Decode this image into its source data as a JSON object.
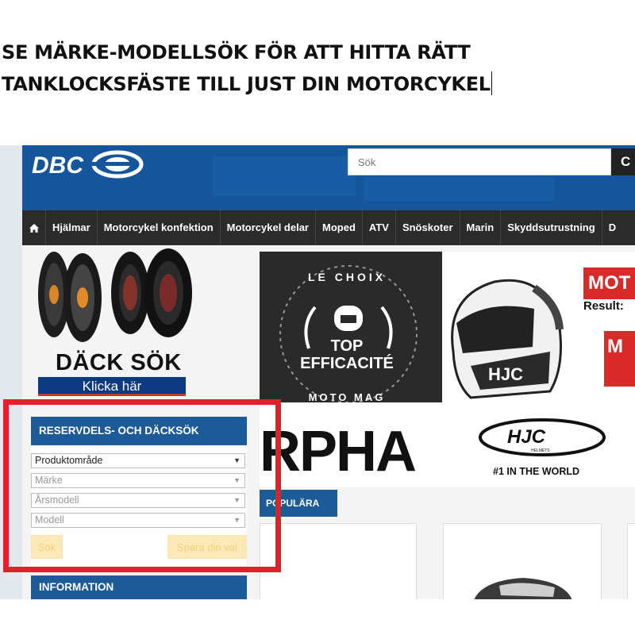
{
  "instruction": {
    "line1": "SE MÄRKE-MODELLSÖK FÖR ATT HITTA RÄTT",
    "line2": "TANKLOCKSFÄSTE TILL JUST DIN MOTORCYKEL"
  },
  "site": {
    "logo_text": "DBC",
    "search_placeholder": "Sök",
    "search_button": "C"
  },
  "nav": {
    "home_icon": "home-icon",
    "items": [
      "Hjälmar",
      "Motorcykel konfektion",
      "Motorcykel delar",
      "Moped",
      "ATV",
      "Snöskoter",
      "Marin",
      "Skyddsutrustning",
      "D"
    ]
  },
  "tire_promo": {
    "title": "DÄCK SÖK",
    "button": "Klicka här"
  },
  "parts_search": {
    "heading": "RESERVDELS- OCH DÄCKSÖK",
    "product_area": "Produktområde",
    "brand": "Märke",
    "year_model": "Årsmodell",
    "model": "Modell",
    "search_button": "Sök",
    "save_button": "Spara din val"
  },
  "info": {
    "heading": "INFORMATION"
  },
  "banner": {
    "badge_top": "LE CHOIX",
    "badge_mid1": "TOP",
    "badge_mid2": "EFFICACITÉ",
    "badge_bottom": "MOTO MAG",
    "model_text": "RPHA",
    "brand_logo": "HJC",
    "brand_sub": "HELMETS",
    "tagline": "#1 IN THE WORLD",
    "moto_text": "MOT",
    "result_text": "Result:",
    "red_letter": "M"
  },
  "popular": {
    "tab": "POPULÄRA"
  },
  "colors": {
    "header_blue": "#15559c",
    "nav_dark": "#2b2b2b",
    "panel_blue": "#1c5a98",
    "highlight_red": "#e0202a",
    "button_cream": "#fbe9b8"
  }
}
